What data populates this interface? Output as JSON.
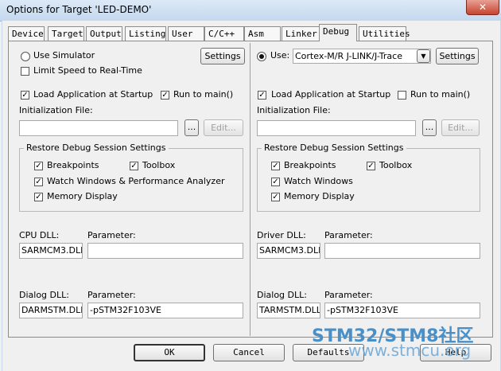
{
  "window": {
    "title": "Options for Target 'LED-DEMO'",
    "close": "✕"
  },
  "tabs": [
    "Device",
    "Target",
    "Output",
    "Listing",
    "User",
    "C/C++",
    "Asm",
    "Linker",
    "Debug",
    "Utilities"
  ],
  "left": {
    "use_simulator": "Use Simulator",
    "limit_speed": "Limit Speed to Real-Time",
    "settings": "Settings",
    "load_app": "Load Application at Startup",
    "run_to_main": "Run to main()",
    "init_file": "Initialization File:",
    "browse": "...",
    "edit": "Edit...",
    "restore_group": "Restore Debug Session Settings",
    "breakpoints": "Breakpoints",
    "toolbox": "Toolbox",
    "watch": "Watch Windows & Performance Analyzer",
    "memory": "Memory Display",
    "cpu_dll_label": "CPU DLL:",
    "param_label": "Parameter:",
    "cpu_dll": "SARMCM3.DLL",
    "cpu_param": "",
    "dialog_dll_label": "Dialog DLL:",
    "dialog_dll": "DARMSTM.DLL",
    "dialog_param": "-pSTM32F103VE"
  },
  "right": {
    "use": "Use:",
    "driver": "Cortex-M/R J-LINK/J-Trace",
    "settings": "Settings",
    "load_app": "Load Application at Startup",
    "run_to_main": "Run to main()",
    "init_file": "Initialization File:",
    "browse": "...",
    "edit": "Edit...",
    "restore_group": "Restore Debug Session Settings",
    "breakpoints": "Breakpoints",
    "toolbox": "Toolbox",
    "watch": "Watch Windows",
    "memory": "Memory Display",
    "driver_dll_label": "Driver DLL:",
    "param_label": "Parameter:",
    "driver_dll": "SARMCM3.DLL",
    "driver_param": "",
    "dialog_dll_label": "Dialog DLL:",
    "dialog_dll": "TARMSTM.DLL",
    "dialog_param": "-pSTM32F103VE"
  },
  "footer": {
    "ok": "OK",
    "cancel": "Cancel",
    "defaults": "Defaults",
    "help": "Help"
  },
  "watermark": {
    "brand": "STM32/STM8社区",
    "url": "www.stmcu.org"
  },
  "checkmark": "✓",
  "dropdown_arrow": "▼"
}
